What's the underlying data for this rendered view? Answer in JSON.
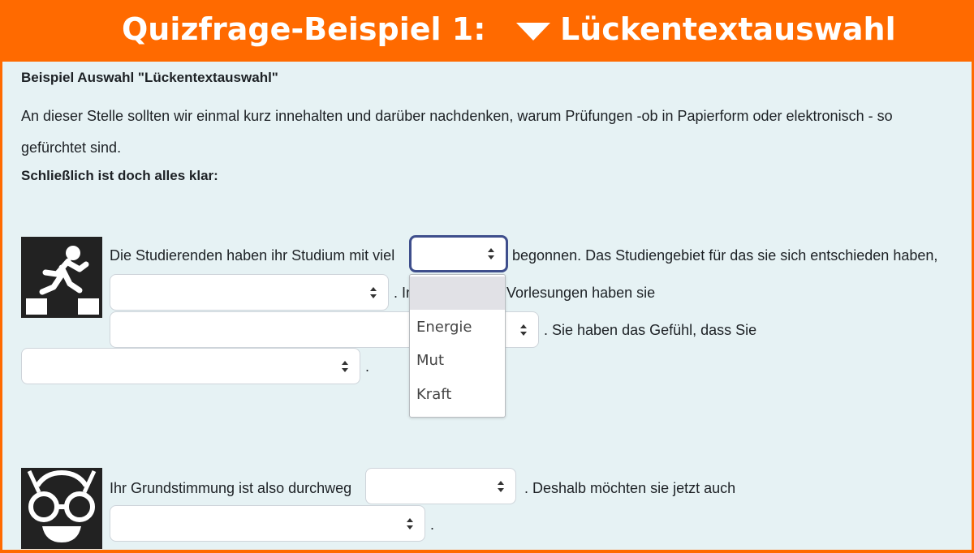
{
  "header": {
    "title_left": "Quizfrage-Beispiel 1:",
    "title_right": "Lückentextauswahl"
  },
  "content": {
    "heading": "Beispiel Auswahl \"Lückentextauswahl\"",
    "intro_line1": "An dieser Stelle sollten wir einmal kurz innehalten und darüber nachdenken, warum Prüfungen -ob in Papierform oder elektronisch - so",
    "intro_line2": "gefürchtet sind.",
    "subheading": "Schließlich ist doch alles klar:",
    "q1": {
      "text1": "Die Studierenden haben ihr Studium mit viel",
      "text2": "begonnen. Das Studiengebiet für das sie sich entschieden haben,",
      "text3": ". In",
      "text4": "Vorlesungen haben sie",
      "text5": ". Sie haben das Gefühl, dass Sie",
      "text6": "."
    },
    "q2": {
      "text1": "Ihr Grundstimmung ist also durchweg",
      "text2": ". Deshalb möchten sie jetzt auch",
      "text3": "."
    }
  },
  "dropdown": {
    "selected": "",
    "options": [
      "Energie",
      "Mut",
      "Kraft"
    ]
  },
  "icons": [
    "jumping-person-icon",
    "goggles-face-icon"
  ],
  "colors": {
    "header_bg": "#ff6a00",
    "content_bg": "#e6f2f4",
    "focus_border": "#3e4e8c"
  }
}
